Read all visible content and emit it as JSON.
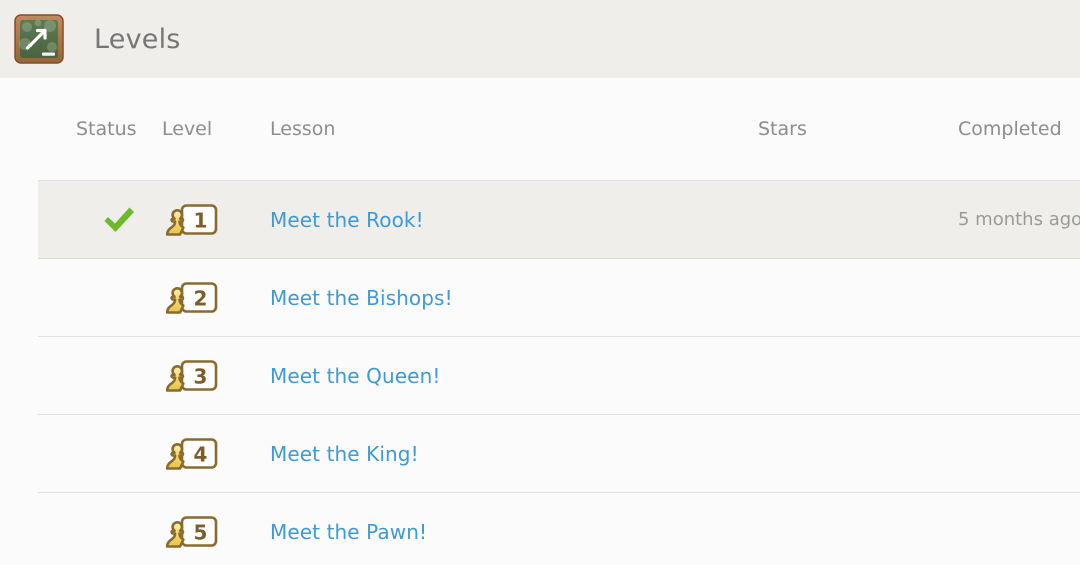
{
  "header": {
    "title": "Levels",
    "icon": "chalkboard-arrow-icon"
  },
  "table": {
    "columns": [
      {
        "key": "status",
        "label": "Status"
      },
      {
        "key": "level",
        "label": "Level"
      },
      {
        "key": "lesson",
        "label": "Lesson"
      },
      {
        "key": "stars",
        "label": "Stars"
      },
      {
        "key": "completed",
        "label": "Completed"
      }
    ],
    "rows": [
      {
        "status": "complete",
        "status_icon": "green-check-icon",
        "level": "1",
        "lesson": "Meet the Rook!",
        "stars": "",
        "completed": "5 months ago",
        "highlighted": true
      },
      {
        "status": "",
        "status_icon": "",
        "level": "2",
        "lesson": "Meet the Bishops!",
        "stars": "",
        "completed": "",
        "highlighted": false
      },
      {
        "status": "",
        "status_icon": "",
        "level": "3",
        "lesson": "Meet the Queen!",
        "stars": "",
        "completed": "",
        "highlighted": false
      },
      {
        "status": "",
        "status_icon": "",
        "level": "4",
        "lesson": "Meet the King!",
        "stars": "",
        "completed": "",
        "highlighted": false
      },
      {
        "status": "",
        "status_icon": "",
        "level": "5",
        "lesson": "Meet the Pawn!",
        "stars": "",
        "completed": "",
        "highlighted": false
      }
    ]
  },
  "colors": {
    "header_bg": "#efeeea",
    "page_bg": "#fbfbfb",
    "title_text": "#767676",
    "column_header_text": "#8d8d8d",
    "link": "#3d9ad4",
    "check_green": "#6cb92c",
    "badge_gold": "#f3d77a",
    "badge_outline": "#8a6b2f",
    "row_highlight_bg": "#efeeea",
    "divider": "#e2e1de",
    "timestamp_text": "#9a9a96"
  }
}
